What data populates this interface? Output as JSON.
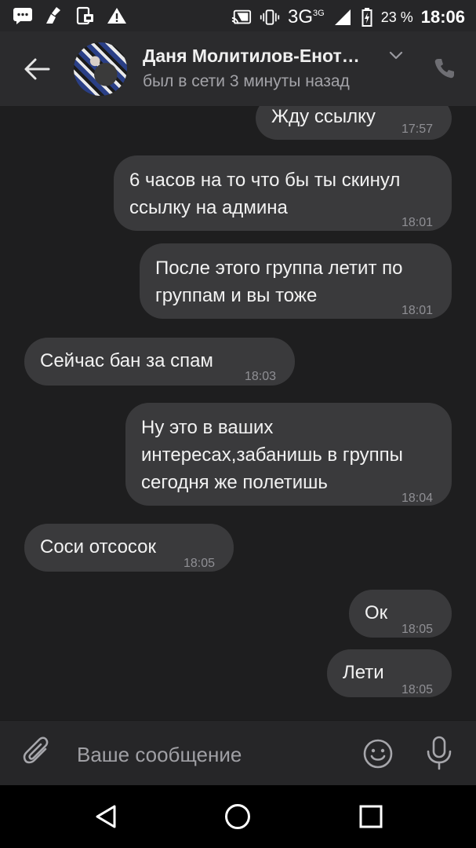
{
  "status_bar": {
    "network": "3G",
    "network_sup": "3G",
    "battery_pct": "23 %",
    "time": "18:06",
    "icons": [
      "vk-message-icon",
      "cleaner-icon",
      "device-manager-icon",
      "warning-icon",
      "cast-icon",
      "vibrate-icon",
      "signal-icon",
      "battery-icon"
    ]
  },
  "header": {
    "contact_name": "Даня Молитилов-Енот…",
    "status": "был в сети 3 минуты назад",
    "icons": [
      "back-arrow-icon",
      "chevron-down-icon",
      "phone-icon"
    ]
  },
  "messages": [
    {
      "side": "out",
      "text": "Жду ссылку",
      "time": "17:57"
    },
    {
      "side": "out",
      "text": "6 часов на то что бы ты скинул\nссылку на админа",
      "time": "18:01"
    },
    {
      "side": "out",
      "text": "После этого группа летит по\nгруппам и вы тоже",
      "time": "18:01"
    },
    {
      "side": "in",
      "text": "Сейчас бан за спам",
      "time": "18:03"
    },
    {
      "side": "out",
      "text": "Ну это в ваших\nинтересах,забанишь в группы\nсегодня же полетишь",
      "time": "18:04"
    },
    {
      "side": "in",
      "text": "Соси отсосок",
      "time": "18:05"
    },
    {
      "side": "out",
      "text": "Ок",
      "time": "18:05"
    },
    {
      "side": "out",
      "text": "Лети",
      "time": "18:05"
    }
  ],
  "composer": {
    "placeholder": "Ваше сообщение",
    "value": "",
    "icons": [
      "paperclip-icon",
      "emoji-icon",
      "microphone-icon"
    ]
  },
  "nav": {
    "icons": [
      "back-triangle-icon",
      "home-circle-icon",
      "recents-square-icon"
    ]
  },
  "colors": {
    "background": "#1e1e1f",
    "bubble": "#3a3a3c",
    "header": "#2b2b2d",
    "muted_text": "#8f8f94"
  }
}
